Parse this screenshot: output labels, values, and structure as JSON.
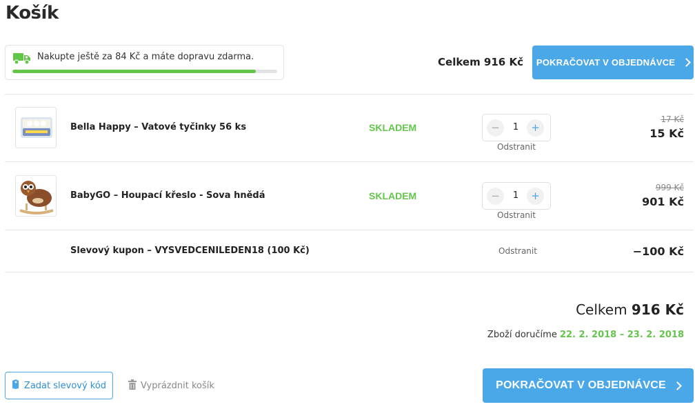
{
  "page": {
    "title": "Košík"
  },
  "shipping": {
    "message": "Nakupte ještě za 84 Kč a máte dopravu zdarma.",
    "progress_fraction": 0.92,
    "icon": "truck-icon"
  },
  "header": {
    "total_label": "Celkem 916 Kč",
    "continue_label": "POKRAČOVAT V OBJEDNÁVCE"
  },
  "items": [
    {
      "name": "Bella Happy – Vatové tyčinky 56 ks",
      "stock": "SKLADEM",
      "quantity": "1",
      "minus": "−",
      "plus": "+",
      "remove": "Odstranit",
      "old_price": "17 Kč",
      "price": "15 Kč"
    },
    {
      "name": "BabyGO – Houpací křeslo - Sova hnědá",
      "stock": "SKLADEM",
      "quantity": "1",
      "minus": "−",
      "plus": "+",
      "remove": "Odstranit",
      "old_price": "999 Kč",
      "price": "901 Kč"
    }
  ],
  "coupon": {
    "name": "Slevový kupon – VYSVEDCENILEDEN18 (100 Kč)",
    "remove": "Odstranit",
    "amount": "−100 Kč"
  },
  "summary": {
    "total_prefix": "Celkem",
    "total_value": "916 Kč",
    "delivery_prefix": "Zboží doručíme",
    "delivery_dates": "22. 2. 2018 – 23. 2. 2018"
  },
  "footer": {
    "coupon_button": "Zadat slevový kód",
    "empty_cart": "Vyprázdnit košík",
    "continue_label": "POKRAČOVAT V OBJEDNÁVCE"
  },
  "colors": {
    "accent_blue": "#4aa8e8",
    "stock_green": "#63c54a"
  }
}
